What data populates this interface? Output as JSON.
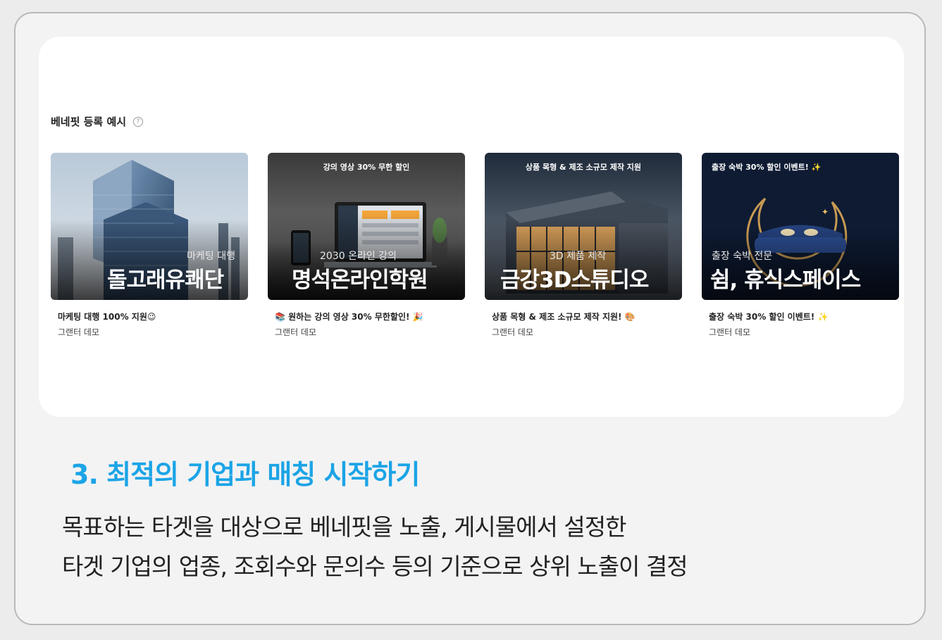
{
  "section": {
    "title": "베네핏 등록 예시",
    "help_icon": "?"
  },
  "cards": [
    {
      "top_label": "",
      "sub_label": "마케팅 대행",
      "big_label": "돌고래유쾌단",
      "desc": "마케팅 대행 100% 지원😉",
      "author": "그랜터 데모"
    },
    {
      "top_label": "강의 영상 30% 무한 할인",
      "sub_label": "2030 온라인 강의",
      "big_label": "명석온라인학원",
      "desc": "📚 원하는 강의 영상 30% 무한할인! 🎉",
      "author": "그랜터 데모"
    },
    {
      "top_label": "상품 목형 & 제조 소규모 제작 지원",
      "sub_label": "3D 제품 제작",
      "big_label": "금강3D스튜디오",
      "desc": "상품 목형 & 제조 소규모 제작 지원! 🎨",
      "author": "그랜터 데모"
    },
    {
      "top_label": "출장 숙박 30% 할인 이벤트! ✨",
      "sub_label": "출장 숙박 전문",
      "big_label": "쉼, 휴식스페이스",
      "desc": "출장 숙박 30% 할인 이벤트! ✨",
      "author": "그랜터 데모"
    }
  ],
  "heading": "3. 최적의 기업과 매칭 시작하기",
  "body": {
    "line1": "목표하는 타겟을 대상으로 베네핏을 노출, 게시물에서 설정한",
    "line2": "타겟 기업의 업종, 조회수와 문의수 등의 기준으로 상위 노출이 결정"
  },
  "colors": {
    "accent": "#1ba4e6",
    "frame_border": "#b9b9bc"
  }
}
